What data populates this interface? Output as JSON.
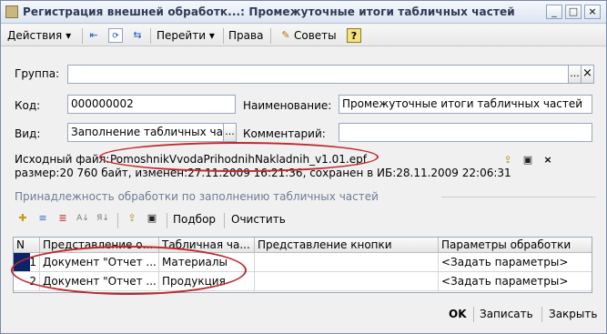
{
  "window": {
    "title": "Регистрация внешней обработк...: Промежуточные итоги табличных частей",
    "minimize": "_",
    "maximize": "□",
    "close": "×"
  },
  "toolbar": {
    "actions": "Действия",
    "goto": "Перейти",
    "rights": "Права",
    "tips": "Советы",
    "help": "?"
  },
  "form": {
    "group_label": "Группа:",
    "group_value": "",
    "code_label": "Код:",
    "code_value": "000000002",
    "name_label": "Наименование:",
    "name_value": "Промежуточные итоги табличных частей",
    "kind_label": "Вид:",
    "kind_value": "Заполнение табличных ча",
    "comment_label": "Комментарий:",
    "comment_value": "",
    "source_label": "Исходный файл:",
    "source_file": "PomoshnikVvodaPrihodnihNakladnih_v1.01.epf",
    "source_info": "размер:20 760 байт, изменен:27.11.2009 16:21:36, сохранен в ИБ:28.11.2009 22:06:31",
    "dots": "..."
  },
  "section": {
    "title": "Принадлежность обработки по заполнению табличных частей",
    "pick_label": "Подбор",
    "clear_label": "Очистить"
  },
  "table": {
    "columns": [
      "N",
      "Представление о...",
      "Табличная ча...",
      "Представление кнопки",
      "Параметры обработки"
    ],
    "rows": [
      {
        "n": "1",
        "repr": "Документ \"Отчет ...",
        "table": "Материалы",
        "button": "",
        "params": "<Задать параметры>"
      },
      {
        "n": "2",
        "repr": "Документ \"Отчет ...",
        "table": "Продукция",
        "button": "",
        "params": "<Задать параметры>"
      }
    ]
  },
  "footer": {
    "ok": "OK",
    "save": "Записать",
    "close": "Закрыть"
  }
}
